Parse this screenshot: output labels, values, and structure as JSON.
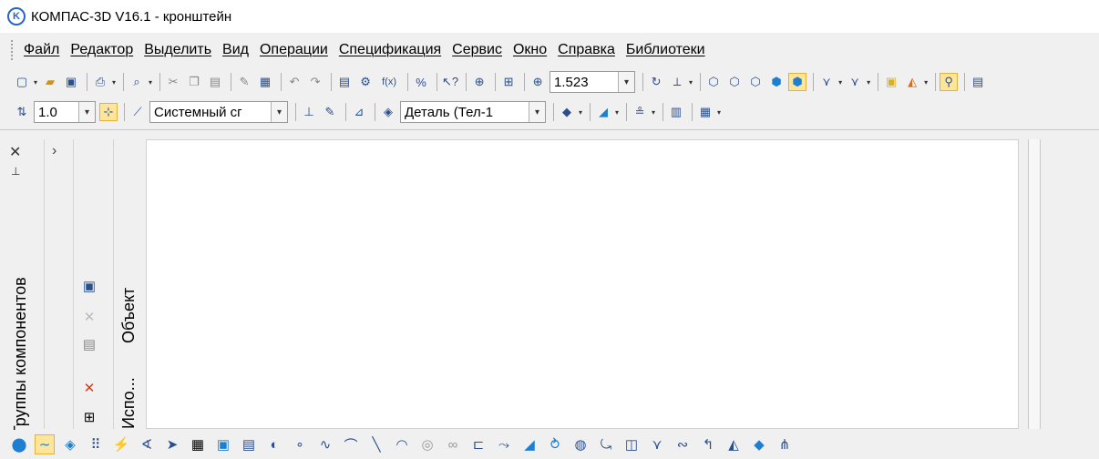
{
  "window": {
    "title": "КОМПАС-3D V16.1 - кронштейн"
  },
  "menu": {
    "items": [
      {
        "label": "Файл"
      },
      {
        "label": "Редактор"
      },
      {
        "label": "Выделить"
      },
      {
        "label": "Вид"
      },
      {
        "label": "Операции"
      },
      {
        "label": "Спецификация"
      },
      {
        "label": "Сервис"
      },
      {
        "label": "Окно"
      },
      {
        "label": "Справка"
      },
      {
        "label": "Библиотеки"
      }
    ]
  },
  "toolbar1": {
    "fx_label": "f(x)",
    "zoom_value": "1.523"
  },
  "toolbar2": {
    "step_value": "1.0",
    "coord_system": "Системный сг",
    "object_type": "Деталь (Тел-1"
  },
  "panels": {
    "component_groups_label": "Группы компонентов",
    "object_label": "Объект",
    "uses_label": "Испо..."
  },
  "icons": {
    "close": "close-icon",
    "pin": "pin-icon",
    "expand": "chevron-right-icon"
  },
  "colors": {
    "accent": "#2a64c8",
    "active_button_bg": "#fde59a"
  }
}
